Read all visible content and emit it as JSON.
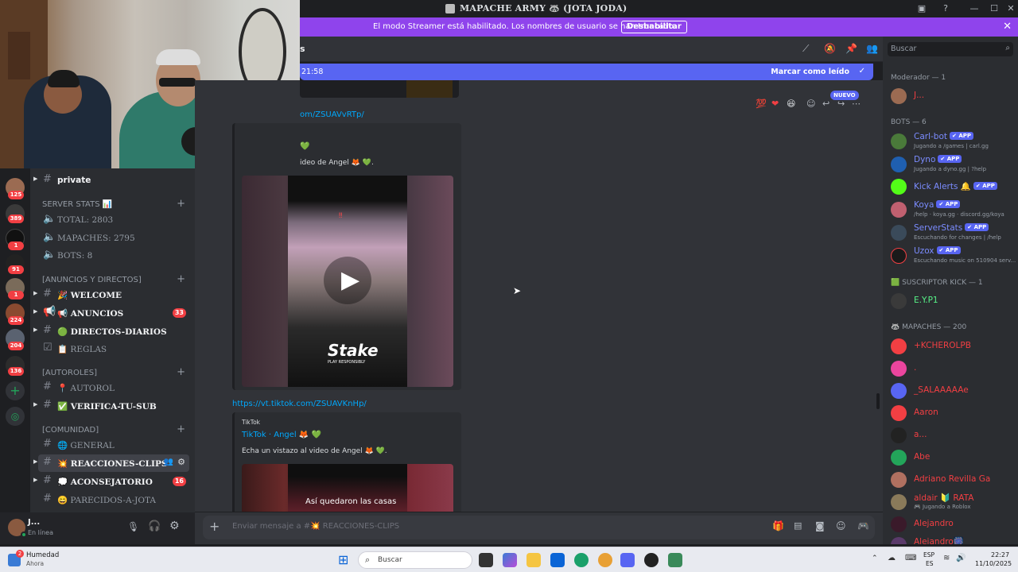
{
  "window": {
    "title": "MAPACHE ARMY 🦝 (JOTA JODA)"
  },
  "banner": {
    "message": "El modo Streamer está habilitado. Los nombres de usuario se han truncado.",
    "button": "Deshabilitar"
  },
  "header": {
    "channel_fragment": "s"
  },
  "new_messages": {
    "time": "21:58",
    "mark_read": "Marcar como leído"
  },
  "new_badge": "NUEVO",
  "channels": {
    "top_item": "private",
    "categories": [
      {
        "name": "SERVER STATS 📊",
        "items": [
          "TOTAL: 2803",
          "MAPACHES: 2795",
          "BOTS: 8"
        ]
      },
      {
        "name": "[ANUNCIOS Y DIRECTOS]"
      },
      {
        "name": "[AUTOROLES]"
      },
      {
        "name": "[COMUNIDAD]"
      }
    ],
    "list": [
      {
        "label": "🎉 WELCOME"
      },
      {
        "label": "📢 ANUNCIOS",
        "badge": "33"
      },
      {
        "label": "🟢 DIRECTOS-DIARIOS"
      },
      {
        "label": "📋 REGLAS"
      },
      {
        "label": "📍 AUTOROL"
      },
      {
        "label": "✅ VERIFICA-TU-SUB"
      },
      {
        "label": "🌐 GENERAL"
      },
      {
        "label": "💥 REACCIONES-CLIPS"
      },
      {
        "label": "💭 ACONSEJATORIO",
        "badge": "16"
      },
      {
        "label": "😄 PARECIDOS-A-JOTA"
      }
    ]
  },
  "server_badges": [
    "125",
    "389",
    "1",
    "91",
    "1",
    "224",
    "204",
    "136"
  ],
  "user": {
    "name": "J...",
    "status": "En línea"
  },
  "chat": {
    "link1": "om/ZSUAVvRTp/",
    "embed1_text": "ideo de Angel 🦊 💚.",
    "link2": "https://vt.tiktok.com/ZSUAVKnHp/",
    "embed2_provider": "TikTok",
    "embed2_title": "TikTok · Angel 🦊 💚",
    "embed2_text": "Echa un vistazo al video de Angel 🦊 💚.",
    "video1_brand": "Stake",
    "video1_sub": "PLAY RESPONSIBLY",
    "video2_caption": "Así quedaron las casas"
  },
  "composer": {
    "placeholder": "Enviar mensaje a #💥 REACCIONES-CLIPS"
  },
  "members": {
    "search": "Buscar",
    "groups": [
      {
        "title": "Moderador — 1",
        "members": [
          {
            "name": "J...",
            "color": "#f23f43"
          }
        ]
      },
      {
        "title": "BOTS — 6",
        "members": [
          {
            "name": "Carl-bot",
            "app": "APP",
            "status": "Jugando a /games | carl.gg",
            "color": "#7b8cff"
          },
          {
            "name": "Dyno",
            "app": "APP",
            "status": "Jugando a dyno.gg | ?help",
            "color": "#7b8cff"
          },
          {
            "name": "Kick Alerts 🔔",
            "app": "APP",
            "status": "",
            "color": "#7b8cff"
          },
          {
            "name": "Koya",
            "app": "APP",
            "status": "/help · koya.gg · discord.gg/koya",
            "color": "#7b8cff"
          },
          {
            "name": "ServerStats",
            "app": "APP",
            "status": "Escuchando for changes | /help",
            "color": "#7b8cff"
          },
          {
            "name": "Uzox",
            "app": "APP",
            "status": "Escuchando music on 510904 serv...",
            "color": "#7b8cff"
          }
        ]
      },
      {
        "title": "🟩 SUSCRIPTOR KICK — 1",
        "members": [
          {
            "name": "E.Y.P1",
            "color": "#57f287"
          }
        ]
      },
      {
        "title": "🦝 MAPACHES — 200",
        "members": [
          {
            "name": "+KCHEROLPB",
            "color": "#f23f43"
          },
          {
            "name": ".",
            "color": "#f23f43"
          },
          {
            "name": "_SALAAAAAe",
            "color": "#f23f43"
          },
          {
            "name": "Aaron",
            "color": "#f23f43"
          },
          {
            "name": "a...",
            "color": "#f23f43"
          },
          {
            "name": "Abe",
            "color": "#f23f43"
          },
          {
            "name": "Adriano Revilla Ga",
            "color": "#f23f43"
          },
          {
            "name": "aldair 🔰 RATA",
            "status": "🎮 Jugando a Roblox",
            "color": "#f23f43"
          },
          {
            "name": "Alejandro",
            "color": "#f23f43"
          },
          {
            "name": "Alejandro🎆",
            "color": "#f23f43"
          }
        ]
      }
    ]
  },
  "taskbar": {
    "weather_title": "Humedad",
    "weather_sub": "Ahora",
    "weather_badge": "2",
    "search": "Buscar",
    "lang": "ESP",
    "lang_sub": "ES",
    "time": "22:27",
    "date": "11/10/2025"
  },
  "colors": {
    "accent": "#5865f2",
    "streamer": "#8f44ec",
    "danger": "#f23f43",
    "online": "#23a55a"
  }
}
